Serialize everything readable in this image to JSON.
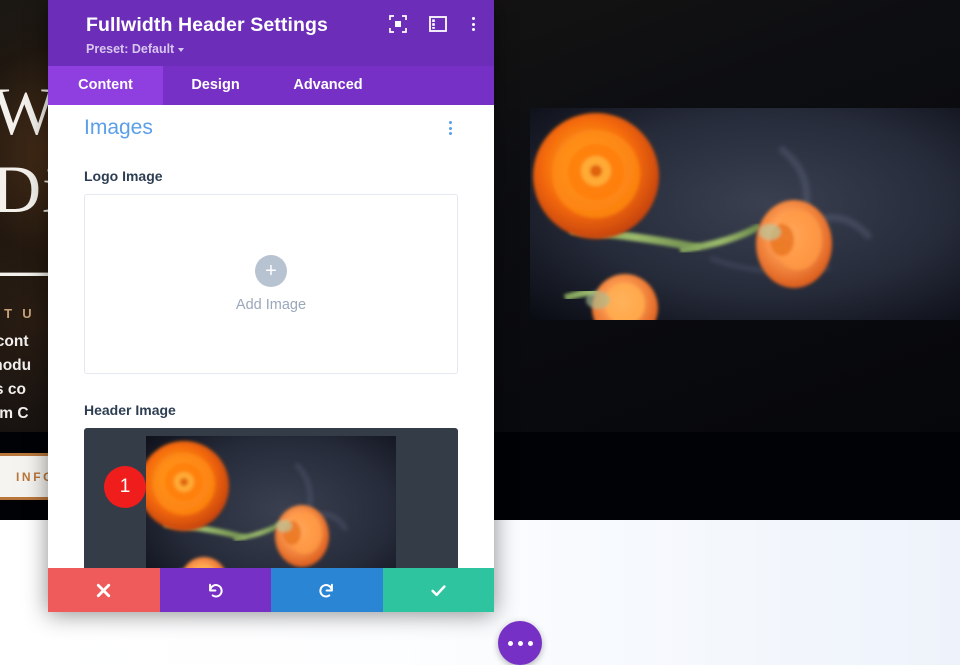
{
  "modal": {
    "title": "Fullwidth Header Settings",
    "preset_label": "Preset: Default",
    "header_icons": [
      {
        "name": "focus-icon"
      },
      {
        "name": "layout-panel-icon"
      },
      {
        "name": "kebab-menu-icon"
      }
    ],
    "tabs": [
      {
        "label": "Content",
        "active": true
      },
      {
        "label": "Design",
        "active": false
      },
      {
        "label": "Advanced",
        "active": false
      }
    ],
    "section": {
      "title": "Images",
      "menu_icon": "kebab-menu-icon"
    },
    "fields": {
      "logo_image": {
        "label": "Logo Image",
        "upload_text": "Add Image",
        "plus_glyph": "+"
      },
      "header_image": {
        "label": "Header Image",
        "badge": "1"
      }
    },
    "footer_buttons": [
      {
        "name": "cancel-button",
        "icon": "close-icon",
        "color": "#ef5b5b"
      },
      {
        "name": "undo-button",
        "icon": "undo-icon",
        "color": "#7730c6"
      },
      {
        "name": "redo-button",
        "icon": "redo-icon",
        "color": "#2a85d4"
      },
      {
        "name": "save-button",
        "icon": "check-icon",
        "color": "#2ec4a0"
      }
    ],
    "colors": {
      "header_purple": "#6c2eb9",
      "tab_bar": "#7730c6",
      "tab_active": "#8f3ee0",
      "section_blue": "#5a9fe8",
      "badge_red": "#f01d1d"
    }
  },
  "fab": {
    "name": "more-options-fab",
    "icon": "ellipsis-icon"
  },
  "background_page": {
    "heading_lines": [
      "We",
      "Div",
      "—a"
    ],
    "eyebrow": "OUT U",
    "body_lines": [
      "ur cont",
      "e modu",
      "this co",
      "stom C"
    ],
    "button_label": "INFOR"
  }
}
